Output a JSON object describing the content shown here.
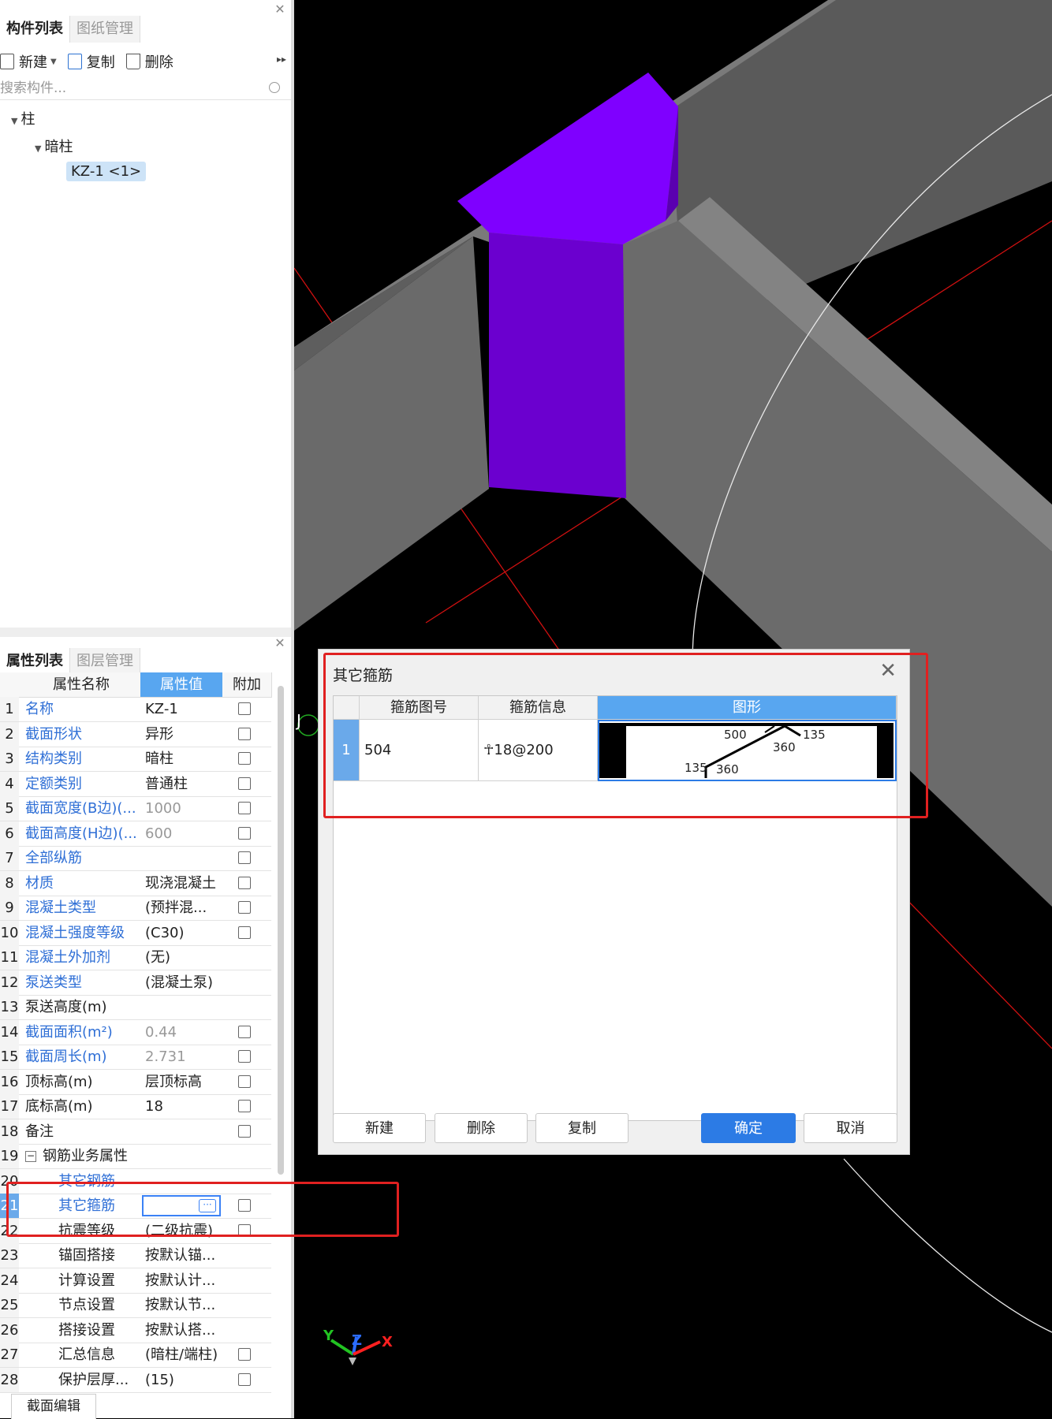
{
  "top_panel": {
    "tabs": [
      "构件列表",
      "图纸管理"
    ],
    "toolbar": {
      "new": "新建",
      "copy": "复制",
      "delete": "删除"
    },
    "search_placeholder": "搜索构件...",
    "tree": {
      "root": "柱",
      "child": "暗柱",
      "leaf": "KZ-1 <1>"
    }
  },
  "prop_panel": {
    "tabs": [
      "属性列表",
      "图层管理"
    ],
    "headers": {
      "name": "属性名称",
      "value": "属性值",
      "extra": "附加"
    },
    "rows": [
      {
        "n": "1",
        "name": "名称",
        "val": "KZ-1"
      },
      {
        "n": "2",
        "name": "截面形状",
        "val": "异形"
      },
      {
        "n": "3",
        "name": "结构类别",
        "val": "暗柱"
      },
      {
        "n": "4",
        "name": "定额类别",
        "val": "普通柱"
      },
      {
        "n": "5",
        "name": "截面宽度(B边)(...",
        "val": "1000"
      },
      {
        "n": "6",
        "name": "截面高度(H边)(...",
        "val": "600"
      },
      {
        "n": "7",
        "name": "全部纵筋",
        "val": ""
      },
      {
        "n": "8",
        "name": "材质",
        "val": "现浇混凝土"
      },
      {
        "n": "9",
        "name": "混凝土类型",
        "val": "(预拌混..."
      },
      {
        "n": "10",
        "name": "混凝土强度等级",
        "val": "(C30)"
      },
      {
        "n": "11",
        "name": "混凝土外加剂",
        "val": "(无)"
      },
      {
        "n": "12",
        "name": "泵送类型",
        "val": "(混凝土泵)"
      },
      {
        "n": "13",
        "name": "泵送高度(m)",
        "val": ""
      },
      {
        "n": "14",
        "name": "截面面积(m²)",
        "val": "0.44"
      },
      {
        "n": "15",
        "name": "截面周长(m)",
        "val": "2.731"
      },
      {
        "n": "16",
        "name": "顶标高(m)",
        "val": "层顶标高"
      },
      {
        "n": "17",
        "name": "底标高(m)",
        "val": "18"
      },
      {
        "n": "18",
        "name": "备注",
        "val": ""
      },
      {
        "n": "19",
        "name": "钢筋业务属性",
        "val": ""
      },
      {
        "n": "20",
        "name": "其它钢筋",
        "val": ""
      },
      {
        "n": "21",
        "name": "其它箍筋",
        "val": ""
      },
      {
        "n": "22",
        "name": "抗震等级",
        "val": "(二级抗震)"
      },
      {
        "n": "23",
        "name": "锚固搭接",
        "val": "按默认锚..."
      },
      {
        "n": "24",
        "name": "计算设置",
        "val": "按默认计..."
      },
      {
        "n": "25",
        "name": "节点设置",
        "val": "按默认节..."
      },
      {
        "n": "26",
        "name": "搭接设置",
        "val": "按默认搭..."
      },
      {
        "n": "27",
        "name": "汇总信息",
        "val": "(暗柱/端柱)"
      },
      {
        "n": "28",
        "name": "保护层厚...",
        "val": "(15)"
      }
    ],
    "edit_button": "···",
    "bottom_tab": "截面编辑"
  },
  "dialog": {
    "title": "其它箍筋",
    "columns": [
      "箍筋图号",
      "箍筋信息",
      "图形"
    ],
    "row": {
      "num": "1",
      "code": "504",
      "info": "☥18@200"
    },
    "shape_labels": [
      "500",
      "135",
      "360",
      "135",
      "360"
    ],
    "buttons": {
      "new": "新建",
      "delete": "删除",
      "copy": "复制",
      "ok": "确定",
      "cancel": "取消"
    }
  },
  "viewport": {
    "axis": [
      "Y",
      "Z",
      "X"
    ],
    "marker": "J"
  }
}
